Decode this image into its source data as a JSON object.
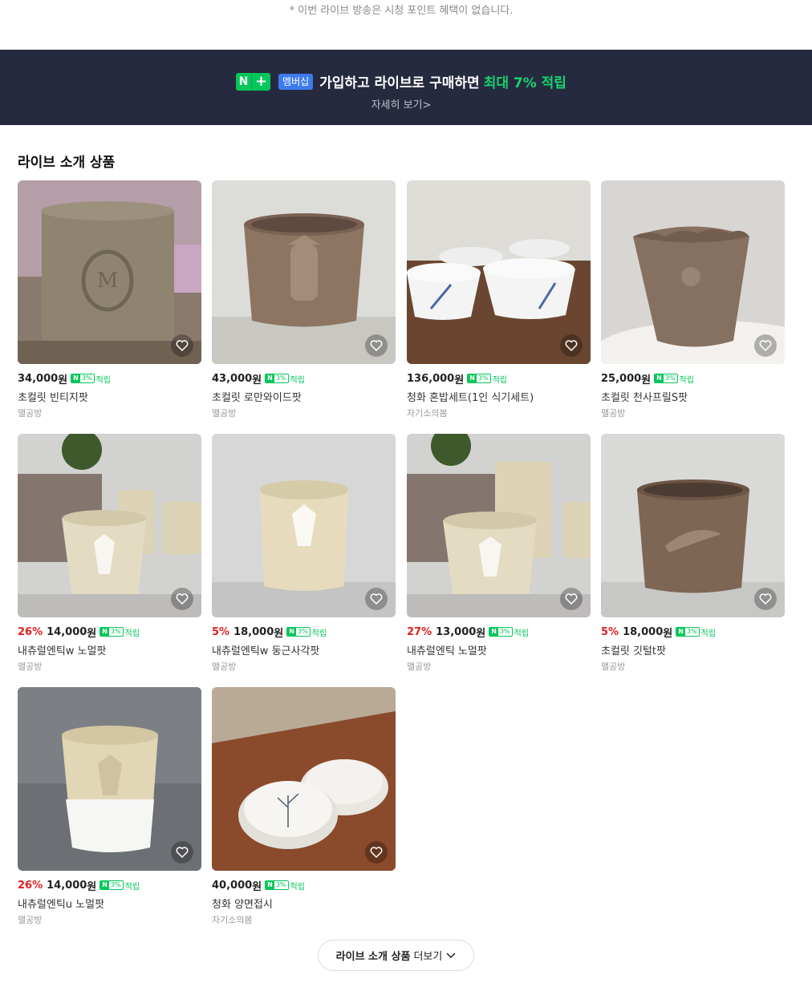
{
  "notice": "* 이번 라이브 방송은 시청 포인트 혜택이 없습니다.",
  "banner": {
    "logo_n": "N",
    "logo_plus": "+",
    "badge": "멤버십",
    "text": "가입하고 라이브로 구매하면",
    "highlight": "최대 7% 적립",
    "link": "자세히 보기>"
  },
  "section_title": "라이브 소개 상품",
  "point_badge": {
    "n": "N",
    "pct": "3%",
    "label": "적립"
  },
  "colors": {
    "banner_bg": "#262a3f",
    "accent_green": "#03c75a",
    "discount_red": "#e02020"
  },
  "products": [
    {
      "discount": "",
      "price": "34,000",
      "currency": "원",
      "name": "초컬릿 빈티지팟",
      "store": "맬공방",
      "image": "chocolate-vintage-pot-photo"
    },
    {
      "discount": "",
      "price": "43,000",
      "currency": "원",
      "name": "초컬릿 로만와이드팟",
      "store": "맬공방",
      "image": "chocolate-roman-wide-pot-photo"
    },
    {
      "discount": "",
      "price": "136,000",
      "currency": "원",
      "name": "청화 혼밥세트(1인 식기세트)",
      "store": "자기소의봄",
      "image": "blue-white-bowl-set-photo"
    },
    {
      "discount": "",
      "price": "25,000",
      "currency": "원",
      "name": "초컬릿 천사프릴S팟",
      "store": "맬공방",
      "image": "chocolate-angel-frill-pot-photo"
    },
    {
      "discount": "26%",
      "price": "14,000",
      "currency": "원",
      "name": "내츄럴엔틱w 노멀팟",
      "store": "맬공방",
      "image": "natural-antique-w-normal-pot-photo"
    },
    {
      "discount": "5%",
      "price": "18,000",
      "currency": "원",
      "name": "내츄럴엔틱w 둥근사각팟",
      "store": "맬공방",
      "image": "natural-antique-w-round-square-pot-photo"
    },
    {
      "discount": "27%",
      "price": "13,000",
      "currency": "원",
      "name": "내츄럴엔틱 노멀팟",
      "store": "맬공방",
      "image": "natural-antique-normal-pot-photo"
    },
    {
      "discount": "5%",
      "price": "18,000",
      "currency": "원",
      "name": "초컬릿 깃털t팟",
      "store": "맬공방",
      "image": "chocolate-feather-pot-photo"
    },
    {
      "discount": "26%",
      "price": "14,000",
      "currency": "원",
      "name": "내츄럴엔틱u 노멀팟",
      "store": "맬공방",
      "image": "natural-antique-u-normal-pot-photo"
    },
    {
      "discount": "",
      "price": "40,000",
      "currency": "원",
      "name": "청화 양면접시",
      "store": "자기소의봄",
      "image": "blue-white-double-plate-photo"
    }
  ],
  "more_button": {
    "bold": "라이브 소개 상품",
    "rest": "더보기"
  }
}
